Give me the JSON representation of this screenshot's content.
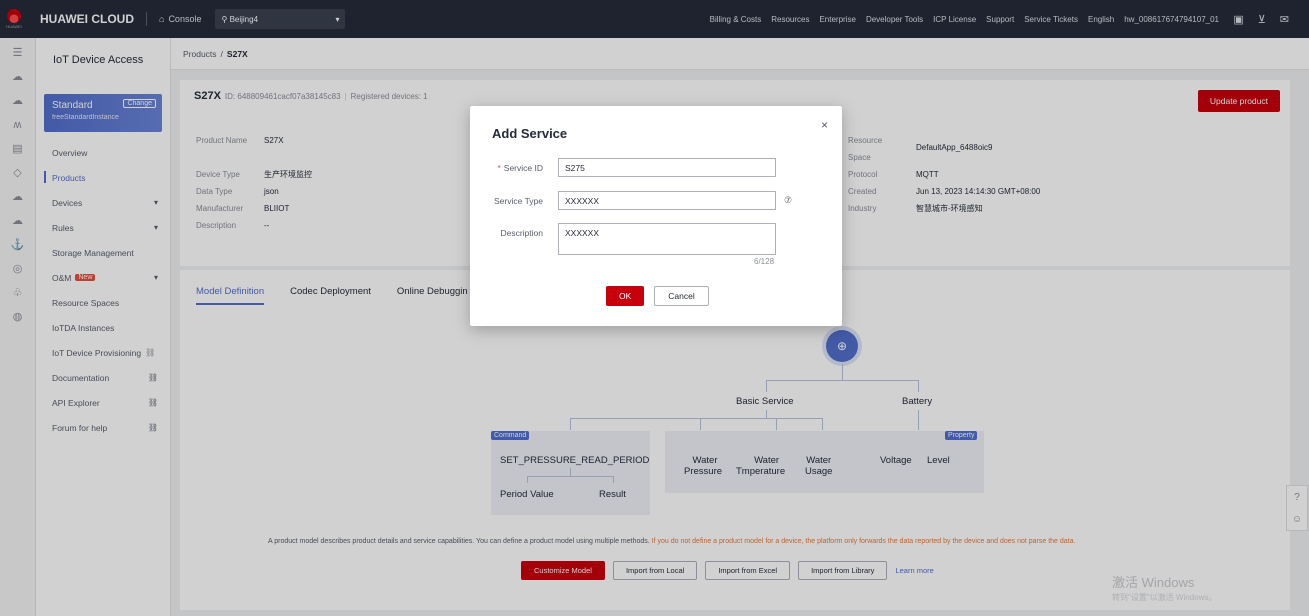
{
  "topbar": {
    "logo_text": "HUAWEI",
    "brand": "HUAWEI CLOUD",
    "console": "Console",
    "region": "Beijing4",
    "links": [
      "Billing & Costs",
      "Resources",
      "Enterprise",
      "Developer Tools",
      "ICP License",
      "Support",
      "Service Tickets",
      "English",
      "hw_008617674794107_01"
    ]
  },
  "nav": {
    "title": "IoT Device Access",
    "edition": {
      "name": "Standard",
      "change": "Change",
      "instance": "freeStandardInstance"
    },
    "items": [
      {
        "label": "Overview"
      },
      {
        "label": "Products"
      },
      {
        "label": "Devices"
      },
      {
        "label": "Rules"
      },
      {
        "label": "Storage Management"
      },
      {
        "label": "O&M",
        "badge": "New"
      },
      {
        "label": "Resource Spaces"
      },
      {
        "label": "IoTDA Instances"
      },
      {
        "label": "IoT Device Provisioning"
      },
      {
        "label": "Documentation"
      },
      {
        "label": "API Explorer"
      },
      {
        "label": "Forum for help"
      }
    ]
  },
  "breadcrumb": {
    "parent": "Products",
    "sep": "/",
    "current": "S27X"
  },
  "product": {
    "name": "S27X",
    "id": "ID: 648809461cacf07a38145c83",
    "registered": "Registered devices: 1",
    "update_button": "Update product",
    "left_props": [
      {
        "label": "Product Name",
        "value": "S27X"
      },
      {
        "label": "Device Type",
        "value": "生产环境监控"
      },
      {
        "label": "Data Type",
        "value": "json"
      },
      {
        "label": "Manufacturer",
        "value": "BLIIOT"
      },
      {
        "label": "Description",
        "value": "--"
      }
    ],
    "right_props": [
      {
        "label": "Resource",
        "value": ""
      },
      {
        "label": "Space",
        "value": "DefaultApp_6488oic9"
      },
      {
        "label": "Protocol",
        "value": "MQTT"
      },
      {
        "label": "Created",
        "value": "Jun 13, 2023 14:14:30 GMT+08:00"
      },
      {
        "label": "Industry",
        "value": "智慧城市-环境感知"
      }
    ]
  },
  "tabs": [
    "Model Definition",
    "Codec Deployment",
    "Online Debuggin"
  ],
  "model": {
    "basic_service": "Basic Service",
    "battery": "Battery",
    "command_tag": "Command",
    "property_tag": "Property",
    "command_name": "SET_PRESSURE_READ_PERIOD",
    "period_value": "Period Value",
    "result": "Result",
    "water_pressure": [
      "Water",
      "Pressure"
    ],
    "water_temperature": [
      "Water",
      "Tmperature"
    ],
    "water_usage": [
      "Water",
      "Usage"
    ],
    "voltage": "Voltage",
    "level": "Level"
  },
  "footer": {
    "desc": "A product model describes product details and service capabilities. You can define a product model using multiple methods.",
    "warn": "If you do not define a product model for a device, the platform only forwards the data reported by the device and does not parse the data.",
    "buttons": [
      "Customize Model",
      "Import from Local",
      "Import from Excel",
      "Import from Library"
    ],
    "learn_more": "Learn more"
  },
  "watermark": {
    "line1": "激活 Windows",
    "line2": "转到\"设置\"以激活 Windows。"
  },
  "dialog": {
    "title": "Add Service",
    "close": "×",
    "service_id_label": "Service ID",
    "service_id_value": "S275",
    "service_type_label": "Service Type",
    "service_type_value": "XXXXXX",
    "description_label": "Description",
    "description_value": "XXXXXX",
    "counter": "6/128",
    "ok": "OK",
    "cancel": "Cancel"
  },
  "colors": {
    "brand_red": "#c7000b",
    "accent_blue": "#526ecc",
    "topbar": "#252b3a"
  }
}
